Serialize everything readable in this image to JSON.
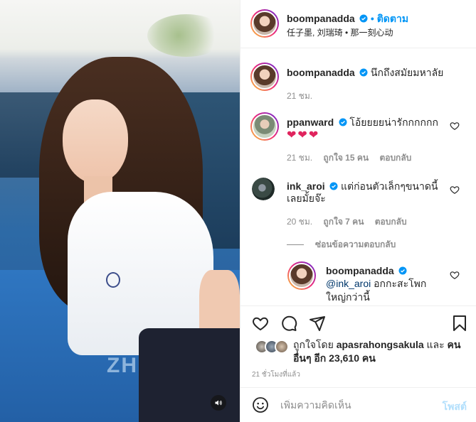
{
  "header": {
    "username": "boompanadda",
    "follow_label": "• ติดตาม",
    "subline": "任子墨, 刘瑞琦 • 那一刻心动"
  },
  "media": {
    "bus_text": "ZHR"
  },
  "comments": [
    {
      "username": "boompanadda",
      "text": "นึกถึงสมัยมหาลัย",
      "time": "21 ชม."
    },
    {
      "username": "ppanward",
      "text": "โอ้ยยยยน่ารักกกกกก",
      "emoji": "❤❤❤",
      "time": "21 ชม.",
      "likes": "ถูกใจ 15 คน",
      "reply_label": "ตอบกลับ"
    },
    {
      "username": "ink_aroi",
      "text_line1": "แต่ก่อนตัวเล็กๆขนาดนี้",
      "text_line2": "เลยมั้ยจ๊ะ",
      "time": "20 ชม.",
      "likes": "ถูกใจ 7 คน",
      "reply_label": "ตอบกลับ",
      "hide_replies_label": "ซ่อนข้อความตอบกลับ"
    },
    {
      "username": "boompanadda",
      "mention": "@ink_aroi",
      "text_line1": " อกกะสะโพก",
      "text_line2": "ใหญ่กว่านี้"
    }
  ],
  "likes": {
    "prefix": "ถูกใจโดย",
    "first_user": "apasrahongsakula",
    "and_word": "และ",
    "others": "คนอื่นๆ อีก 23,610 คน"
  },
  "time_ago": "21 ชั่วโมงที่แล้ว",
  "comment_box": {
    "placeholder": "เพิ่มความคิดเห็น",
    "post_label": "โพสต์"
  },
  "colors": {
    "verified": "#0095f6",
    "follow": "#0095f6",
    "post_disabled": "#b2dffc",
    "heart_emoji": "#e0245e"
  }
}
